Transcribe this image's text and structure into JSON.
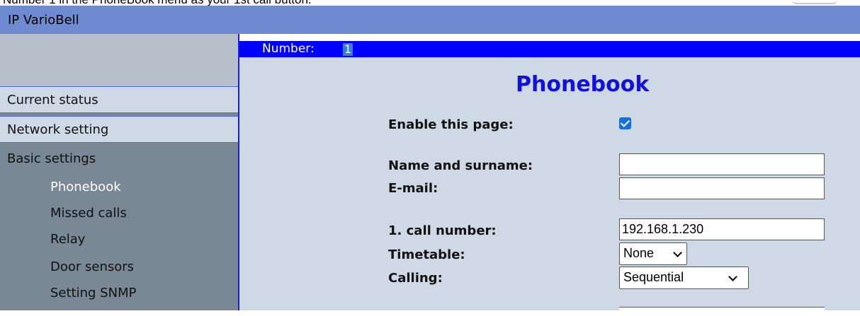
{
  "caption": "Number 1 in the PhoneBook menu as your 1st call button.",
  "app": {
    "title": "IP VarioBell"
  },
  "sidebar": {
    "items": [
      {
        "label": "Current status"
      },
      {
        "label": "Network setting"
      }
    ],
    "section": "Basic settings",
    "subitems": [
      {
        "label": "Phonebook",
        "active": true
      },
      {
        "label": "Missed calls"
      },
      {
        "label": "Relay"
      },
      {
        "label": "Door sensors"
      },
      {
        "label": "Setting SNMP"
      }
    ]
  },
  "numberbar": {
    "label": "Number:",
    "value": "1"
  },
  "page": {
    "title": "Phonebook",
    "enable_label": "Enable this page:",
    "enable_checked": true,
    "name_label": "Name and surname:",
    "name_value": "",
    "email_label": "E-mail:",
    "email_value": "",
    "call1_label": "1. call number:",
    "call1_value": "192.168.1.230",
    "timetable_label": "Timetable:",
    "timetable_value": "None",
    "calling_label": "Calling:",
    "calling_value": "Sequential"
  },
  "colors": {
    "titlebar": "#6e8bd2",
    "numberbar": "#0000ff",
    "page_title": "#1010e0",
    "content_bg": "#cfd9e6",
    "sidebar_bg": "#7a8795"
  }
}
